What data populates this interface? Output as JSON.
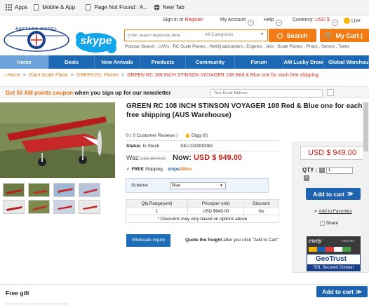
{
  "bookmarks": [
    {
      "label": "Apps",
      "icon": "apps-grid-icon"
    },
    {
      "label": "Mobile & App",
      "icon": "page-icon"
    },
    {
      "label": "Page Not Found : A...",
      "icon": "page-icon"
    },
    {
      "label": "New Tab",
      "icon": "globe-icon"
    }
  ],
  "topbar": {
    "signin": "Sign in",
    "or": " or ",
    "register": "Register",
    "account": "My Account",
    "help": "Help",
    "currency_label": "Currency:",
    "currency_value": "USD $",
    "live": "Live"
  },
  "header": {
    "logo_text": "AUSTARS MODEL",
    "skype_text": "skype",
    "search_placeholder": "Enter search keywords here",
    "category": "All Categories",
    "search_button": "Search",
    "cart_button": "My Cart (",
    "popular": "Popular Search : UAVs , RC Scale Planes , Heli/Quadcopters , Engines , Jets , Scale Planes , Props , Servos , Tanks"
  },
  "nav": [
    "Home",
    "Deals",
    "New Arrivals",
    "Products",
    "Community",
    "Forum",
    "AM Lucky Draw",
    "Global Warehouse"
  ],
  "breadcrumb": {
    "home": "Home",
    "sep": ">",
    "c1": "Giant Scale Plane",
    "c2": "GREEN RC Planes",
    "current": "GREEN RC 108 INCH STINSON VOYAGER 108 Red & Blue one for each free shipping"
  },
  "coupon": {
    "text_orange": "Get 50 AM points coupon",
    "text_black": " when you sign up for our newsletter",
    "email_placeholder": "Your Email Address"
  },
  "product": {
    "title": "GREEN RC 108 INCH STINSON VOYAGER 108 Red & Blue one for each free shipping (AUS Warehouse)",
    "reviews": "0 ( 0 Customer Reviews )",
    "digg": "Digg (0)",
    "status_label": "Status",
    "status_value": ": In Stock",
    "sku": "SKU:GD000082",
    "was_label": "Was:",
    "was_price": "USD $949.00",
    "now_label": "Now:",
    "now_price": "USD $  949.00",
    "free_label": "FREE",
    "shipping": "Shipping",
    "ships24": "ships",
    "hrs": "24hrs",
    "scheme_label": "Scheme",
    "scheme_value": "Blue",
    "table_headers": [
      "Qty.Range(unit)",
      "Price(per unit)",
      "Discount"
    ],
    "table_row": [
      "1",
      "USD $949.00",
      "No"
    ],
    "table_note": "* Discounts may vary based on options above",
    "wholesale": "Wholesale inquiry",
    "quote_bold": "Quote the freight",
    "quote_rest": " after you click \"Add to Cart\""
  },
  "buybox": {
    "price": "USD $ 949.00",
    "qty_label": "QTY :",
    "qty_value": "1",
    "minus": "-",
    "plus": "+",
    "add_to_cart": "Add to cart",
    "favorites": "Add to Favorites",
    "share": "Share",
    "eway": "eway",
    "eway_small": "VERIFIED",
    "geotrust": "GeoTrust",
    "ssl": "SSL Secured Domain"
  },
  "gift": {
    "title": "Free gift",
    "add_to_cart": "Add to cart"
  },
  "colors": {
    "brand_blue": "#1c68b5",
    "accent_orange": "#f27b16",
    "price_red": "#c9251a"
  }
}
